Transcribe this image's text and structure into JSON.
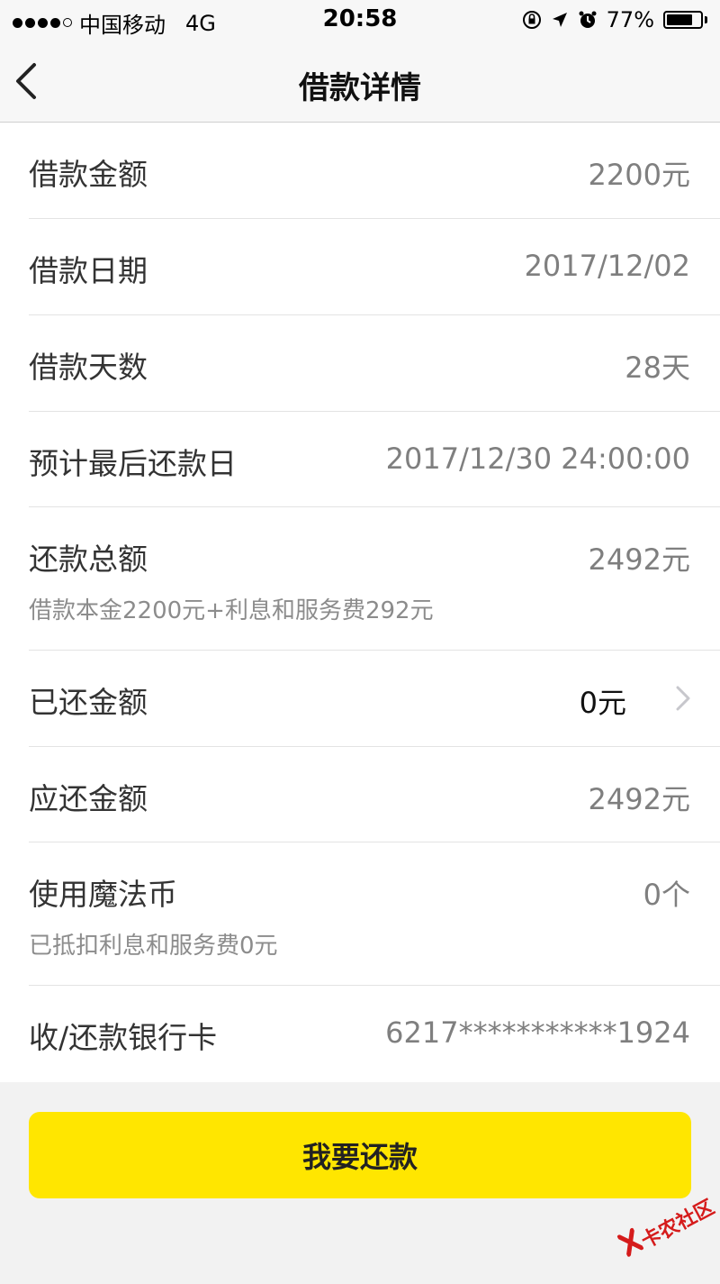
{
  "status_bar": {
    "carrier": "中国移动",
    "network": "4G",
    "time": "20:58",
    "battery": "77%",
    "battery_level": 0.77
  },
  "nav": {
    "title": "借款详情",
    "back_icon": "chevron-left-icon"
  },
  "rows": [
    {
      "label": "借款金额",
      "value": "2200元"
    },
    {
      "label": "借款日期",
      "value": "2017/12/02"
    },
    {
      "label": "借款天数",
      "value": "28天"
    },
    {
      "label": "预计最后还款日",
      "value": "2017/12/30 24:00:00"
    },
    {
      "label": "还款总额",
      "value": "2492元",
      "sub": "借款本金2200元+利息和服务费292元"
    },
    {
      "label": "已还金额",
      "value": "0元"
    },
    {
      "label": "应还金额",
      "value": "2492元"
    },
    {
      "label": "使用魔法币",
      "value": "0个",
      "sub": "已抵扣利息和服务费0元"
    },
    {
      "label": "收/还款银行卡",
      "value": "6217***********1924"
    }
  ],
  "actions": {
    "repay_label": "我要还款"
  },
  "watermark": {
    "text": "卡农社区"
  },
  "colors": {
    "accent": "#ffe600",
    "watermark": "#d51b1b"
  }
}
